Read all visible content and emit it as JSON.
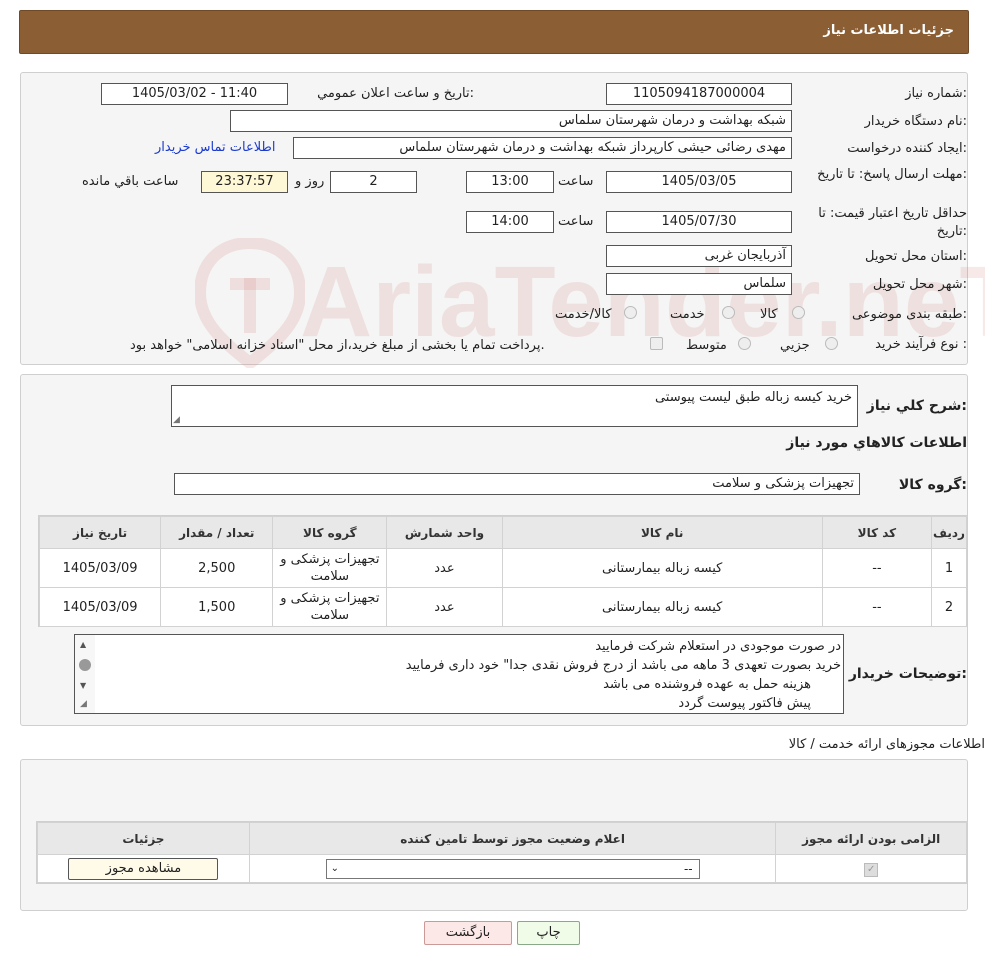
{
  "header": {
    "title": "جزئیات اطلاعات نیاز"
  },
  "watermark": "AriaTender.neT",
  "fields": {
    "need_number_label": "شماره نیاز:",
    "need_number": "1105094187000004",
    "announce_label": "تاریخ و ساعت اعلان عمومي:",
    "announce_value": "1405/03/02 - 11:40",
    "buyer_org_label": "نام دستگاه خريدار:",
    "buyer_org": "شبکه بهداشت و درمان  شهرستان سلماس",
    "creator_label": "ايجاد کننده درخواست:",
    "creator": "مهدی رضائی حیشی کارپرداز شبکه بهداشت و درمان  شهرستان سلماس",
    "contact_link": "اطلاعات تماس خريدار",
    "deadline_label": "مهلت ارسال پاسخ: تا تاریخ:",
    "deadline_date": "1405/03/05",
    "time_word": "ساعت",
    "deadline_time": "13:00",
    "days_value": "2",
    "days_word": "روز و",
    "remaining_time": "23:37:57",
    "remaining_word": "ساعت باقي مانده",
    "validity_label": "حداقل تاريخ اعتبار قيمت: تا تاريخ:",
    "validity_date": "1405/07/30",
    "validity_time": "14:00",
    "province_label": "استان محل تحويل:",
    "province": "آذربايجان غربی",
    "city_label": "شهر محل تحويل:",
    "city": "سلماس",
    "category_label": "طبقه بندی موضوعی:",
    "cat_goods": "کالا",
    "cat_service": "خدمت",
    "cat_both": "کالا/خدمت",
    "process_label": "نوع فرآيند خريد :",
    "proc_minor": "جزيي",
    "proc_medium": "متوسط",
    "proc_note": "پرداخت تمام يا بخشی از مبلغ خريد،از محل \"اسناد خزانه اسلامی\" خواهد بود."
  },
  "description": {
    "label": "شرح کلي نياز:",
    "value": "خرید کیسه زباله طبق لیست پیوستی"
  },
  "goods": {
    "section_title": "اطلاعات کالاهاي مورد نياز",
    "group_label": "گروه کالا:",
    "group_value": "تجهیزات پزشکی و سلامت",
    "columns": [
      "رديف",
      "کد کالا",
      "نام کالا",
      "واحد شمارش",
      "گروه کالا",
      "تعداد / مقدار",
      "تاریخ نیاز"
    ],
    "rows": [
      {
        "idx": "1",
        "code": "--",
        "name": "کیسه زباله بیمارستانی",
        "unit": "عدد",
        "group": "تجهیزات پزشکی و سلامت",
        "qty": "2,500",
        "date": "1405/03/09"
      },
      {
        "idx": "2",
        "code": "--",
        "name": "کیسه زباله بیمارستانی",
        "unit": "عدد",
        "group": "تجهیزات پزشکی و سلامت",
        "qty": "1,500",
        "date": "1405/03/09"
      }
    ]
  },
  "buyer_notes": {
    "label": "توضيحات خريدار:",
    "lines": [
      "در صورت موجودی در استعلام شرکت فرمایید",
      "خرید بصورت تعهدی 3 ماهه می باشد از درج فروش نقدی جدا\" خود داری فرمایید",
      "هزینه حمل به عهده فروشنده می باشد",
      "پیش فاکتور پیوست گردد"
    ]
  },
  "permits": {
    "section_title": "اطلاعات مجوزهای ارائه خدمت / کالا",
    "columns": [
      "الزامی بودن ارائه مجوز",
      "اعلام وضعیت مجوز توسط تامین کننده",
      "جزئیات"
    ],
    "select_value": "--",
    "view_button": "مشاهده مجوز"
  },
  "buttons": {
    "print": "چاپ",
    "back": "بازگشت"
  }
}
